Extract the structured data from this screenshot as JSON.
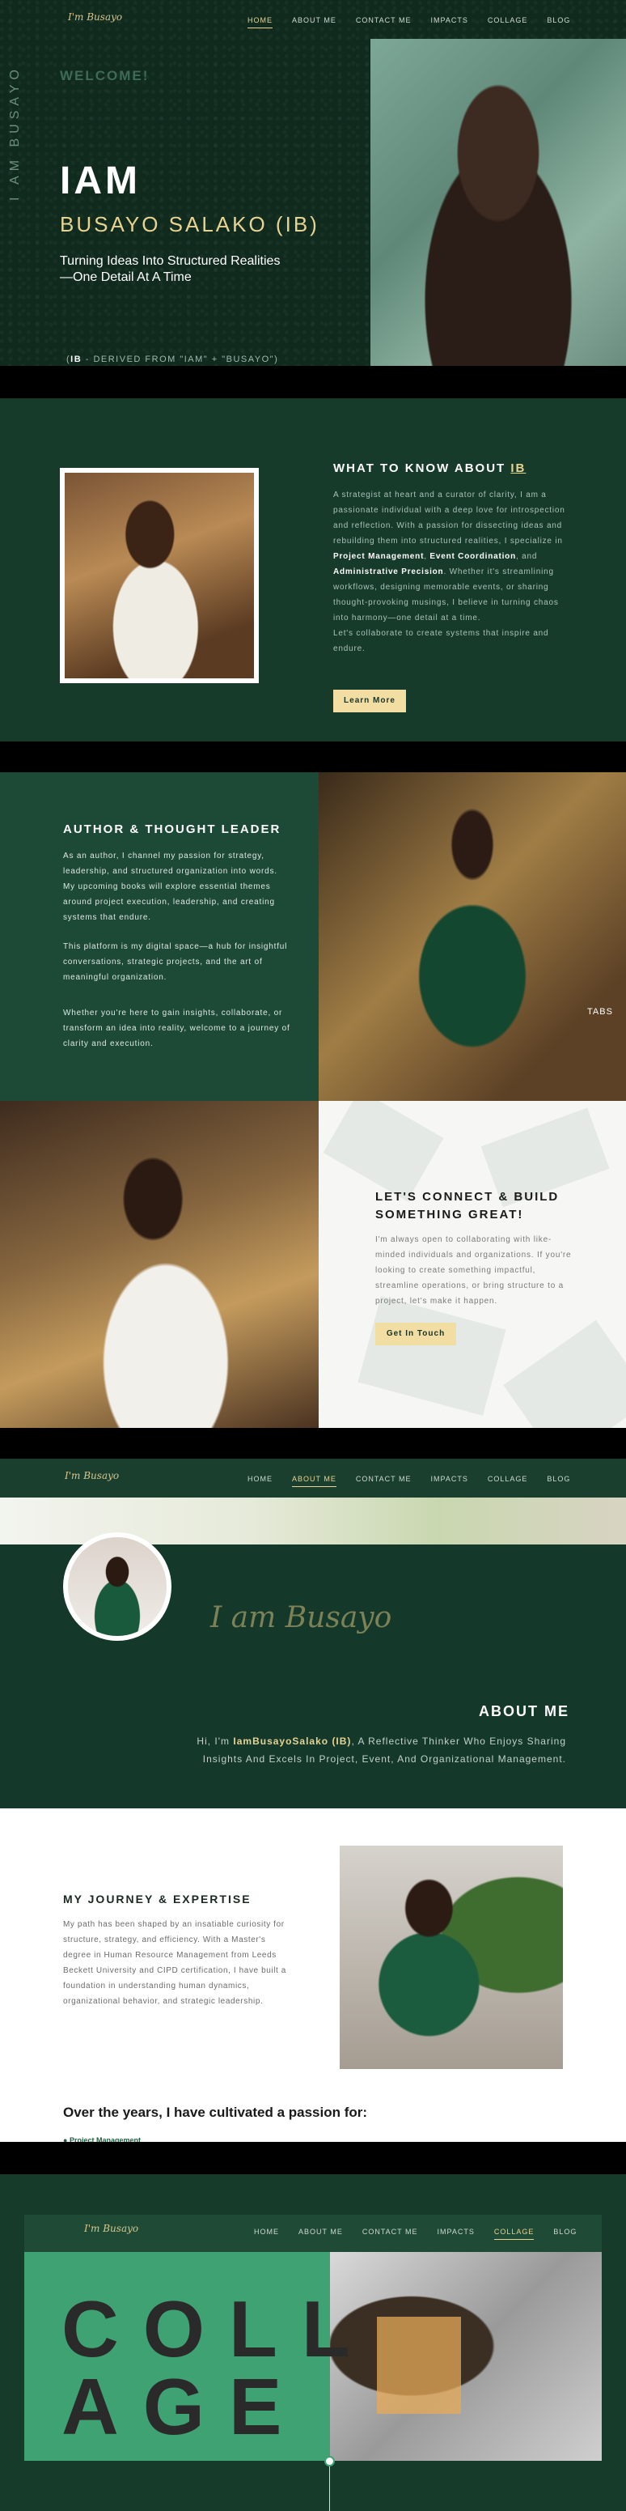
{
  "hero": {
    "logo": "I'm Busayo",
    "nav": [
      "HOME",
      "ABOUT ME",
      "CONTACT ME",
      "IMPACTS",
      "COLLAGE",
      "BLOG"
    ],
    "vertical_text": "I AM BUSAYO",
    "welcome": "WELCOME!",
    "iam": "IAM",
    "name": "BUSAYO SALAKO (IB)",
    "tagline_1": "Turning Ideas Into Structured Realities",
    "tagline_2": "—One Detail At A Time",
    "derived_prefix": "(",
    "derived_bold": "IB",
    "derived_rest": " - DERIVED FROM \"IAM\" + \"BUSAYO\")"
  },
  "about": {
    "title_pre": "WHAT TO KNOW ABOUT ",
    "title_ul": "IB",
    "para_1": "A strategist at heart and a curator of clarity, I am a passionate individual with a deep love for introspection and reflection. With a passion for dissecting ideas and rebuilding them into structured realities, I specialize in",
    "b1": "Project Management",
    "b2": "Event Coordination",
    "b3": "Administrative Precision",
    "para_2": "Whether it's streamlining workflows, designing memorable events, or sharing thought-provoking musings, I believe in turning chaos into harmony—one detail at a time.",
    "para_3": "Let's collaborate to create systems that inspire and endure.",
    "button": "Learn More"
  },
  "author": {
    "title": "AUTHOR & THOUGHT LEADER",
    "para_1": "As an author, I channel my passion for strategy, leadership, and structured organization into words. My upcoming books will explore essential themes around project execution, leadership, and creating systems that endure.",
    "para_2": "This platform is my digital space—a hub for insightful conversations, strategic projects, and the art of meaningful organization.",
    "para_3": "Whether you're here to gain insights, collaborate, or transform an idea into reality, welcome to a journey of clarity and execution.",
    "photo_label": "TABS"
  },
  "connect": {
    "title_1": "LET'S CONNECT & BUILD",
    "title_2": "SOMETHING GREAT!",
    "para": "I'm always open to collaborating with like-minded individuals and organizations. If you're looking to create something impactful, streamline operations, or bring structure to a project, let's make it happen.",
    "button": "Get In Touch"
  },
  "aboutme_page": {
    "logo": "I'm Busayo",
    "nav": [
      "HOME",
      "ABOUT ME",
      "CONTACT ME",
      "IMPACTS",
      "COLLAGE",
      "BLOG"
    ],
    "signature": "I am Busayo",
    "heading": "ABOUT ME",
    "hi_pre": "Hi, I'm ",
    "hi_name": "IamBusayoSalako (IB)",
    "hi_rest": ", A Reflective Thinker Who Enjoys Sharing Insights And Excels In Project, Event, And Organizational Management."
  },
  "journey": {
    "title": "MY JOURNEY & EXPERTISE",
    "para": "My path has been shaped by an insatiable curiosity for structure, strategy, and efficiency. With a Master's degree in Human Resource Management from Leeds Beckett University and CIPD certification, I have built a foundation in understanding human dynamics, organizational behavior, and strategic leadership.",
    "passion": "Over the years, I have cultivated a passion for:",
    "first_item": "Project Management"
  },
  "collage_page": {
    "logo": "I'm Busayo",
    "nav": [
      "HOME",
      "ABOUT ME",
      "CONTACT ME",
      "IMPACTS",
      "COLLAGE",
      "BLOG"
    ],
    "word_1": "COLL",
    "word_2": "AGE"
  },
  "colors": {
    "dark_green": "#102a1e",
    "gold": "#e8d391",
    "accent_green": "#3fa273",
    "button_gold": "#f2dea2"
  }
}
